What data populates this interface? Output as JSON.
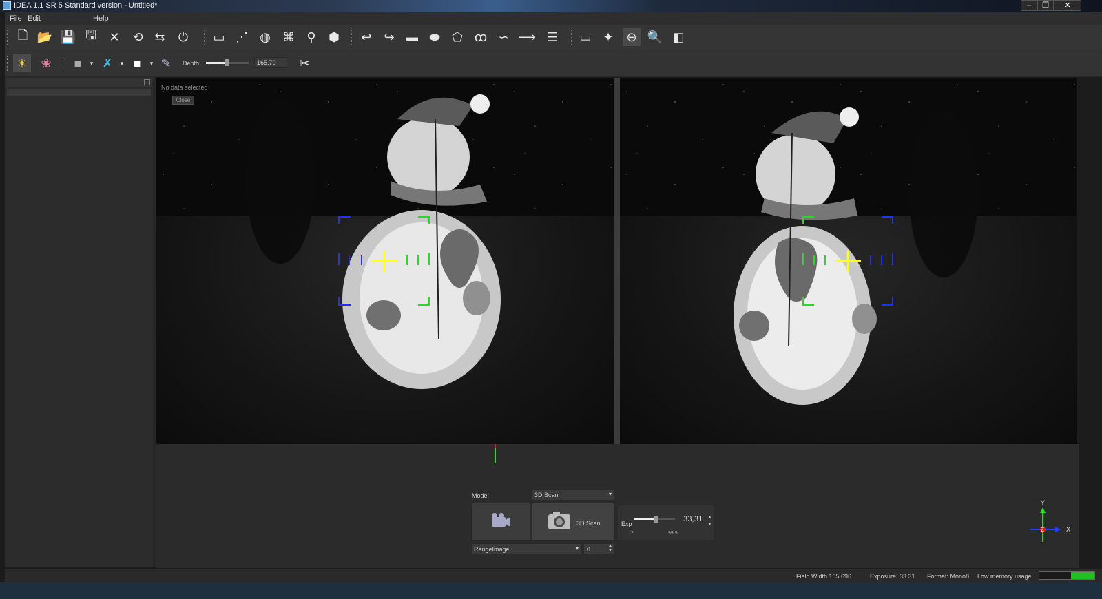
{
  "window": {
    "title": "IDEA 1.1 SR 5 Standard version - Untitled*"
  },
  "menu": {
    "file": "File",
    "edit": "Edit",
    "help": "Help"
  },
  "toolbar2": {
    "depth_label": "Depth:",
    "depth_value": "165,70"
  },
  "viewer": {
    "no_data": "No data selected",
    "close_label": "Close"
  },
  "scan_panel": {
    "mode_label": "Mode:",
    "mode_value": "3D Scan",
    "scan_button_label": "3D Scan",
    "exp_label": "Exp",
    "exp_value": "33,31",
    "exp_min": "2",
    "exp_max": "99.9",
    "output_value": "RangeImage",
    "index_value": "0"
  },
  "axes": {
    "y": "Y",
    "x": "X",
    "z": "Z"
  },
  "status": {
    "field_width": "Field Width 165.696",
    "exposure": "Exposure: 33.31",
    "format": "Format: Mono8",
    "memory": "Low memory usage"
  },
  "colors": {
    "background": "#1c1c1c",
    "panel": "#2c2c2c",
    "target_blue": "#2030ff",
    "target_green": "#20e020",
    "cross_yellow": "#ffff20"
  },
  "icons": [
    "new-file-icon",
    "open-folder-icon",
    "save-icon",
    "save-as-icon",
    "delete-icon",
    "import-icon",
    "export-icon",
    "power-icon",
    "scanner-icon",
    "points-icon",
    "mesh-icon",
    "align-icon",
    "measure-icon",
    "shape-icon",
    "undo-icon",
    "redo-icon",
    "rectangle-icon",
    "ellipse-icon",
    "polygon-icon",
    "lasso-icon",
    "curve-icon",
    "line-icon",
    "layers-icon",
    "window-icon",
    "rotate-icon",
    "turntable-icon",
    "zoom-icon",
    "cube-icon",
    "light-icon",
    "color-icon",
    "square-icon",
    "axis-icon",
    "fill-icon",
    "paint-icon",
    "tools-icon"
  ]
}
